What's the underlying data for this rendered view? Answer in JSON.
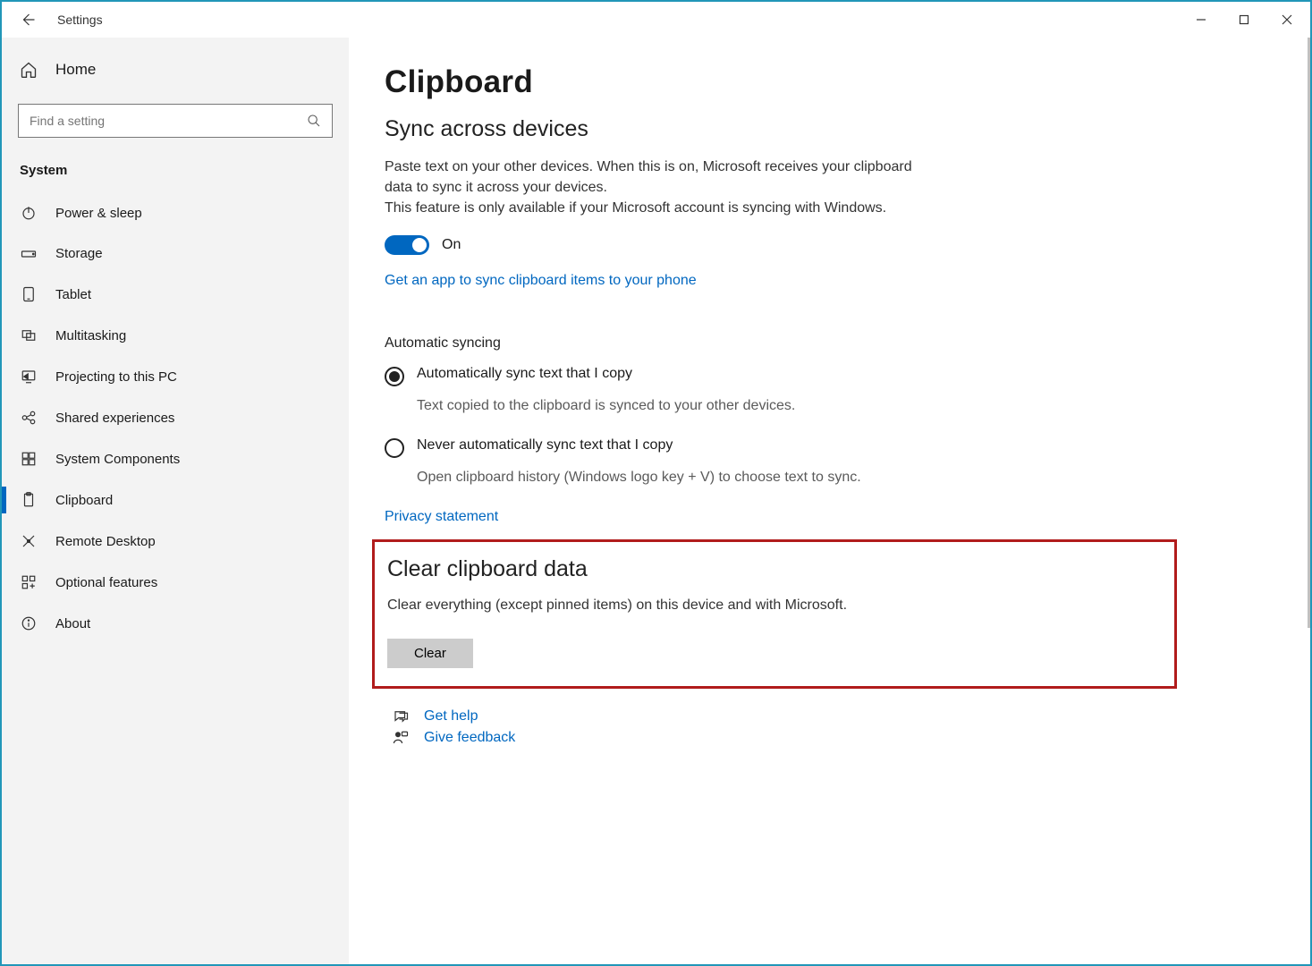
{
  "window": {
    "title": "Settings"
  },
  "sidebar": {
    "home_label": "Home",
    "search_placeholder": "Find a setting",
    "section_label": "System",
    "items": [
      {
        "label": "Power & sleep",
        "icon": "power-icon"
      },
      {
        "label": "Storage",
        "icon": "storage-icon"
      },
      {
        "label": "Tablet",
        "icon": "tablet-icon"
      },
      {
        "label": "Multitasking",
        "icon": "multitasking-icon"
      },
      {
        "label": "Projecting to this PC",
        "icon": "projecting-icon"
      },
      {
        "label": "Shared experiences",
        "icon": "shared-icon"
      },
      {
        "label": "System Components",
        "icon": "components-icon"
      },
      {
        "label": "Clipboard",
        "icon": "clipboard-icon",
        "active": true
      },
      {
        "label": "Remote Desktop",
        "icon": "remote-icon"
      },
      {
        "label": "Optional features",
        "icon": "features-icon"
      },
      {
        "label": "About",
        "icon": "about-icon"
      }
    ]
  },
  "page": {
    "title": "Clipboard",
    "sync": {
      "heading": "Sync across devices",
      "description": "Paste text on your other devices. When this is on, Microsoft receives your clipboard data to sync it across your devices.\nThis feature is only available if your Microsoft account is syncing with Windows.",
      "toggle_label": "On",
      "link": "Get an app to sync clipboard items to your phone",
      "auto_heading": "Automatic syncing",
      "options": [
        {
          "label": "Automatically sync text that I copy",
          "desc": "Text copied to the clipboard is synced to your other devices.",
          "checked": true
        },
        {
          "label": "Never automatically sync text that I copy",
          "desc": "Open clipboard history (Windows logo key + V) to choose text to sync.",
          "checked": false
        }
      ],
      "privacy_link": "Privacy statement"
    },
    "clear": {
      "heading": "Clear clipboard data",
      "description": "Clear everything (except pinned items) on this device and with Microsoft.",
      "button": "Clear"
    },
    "help": {
      "get_help": "Get help",
      "feedback": "Give feedback"
    }
  }
}
